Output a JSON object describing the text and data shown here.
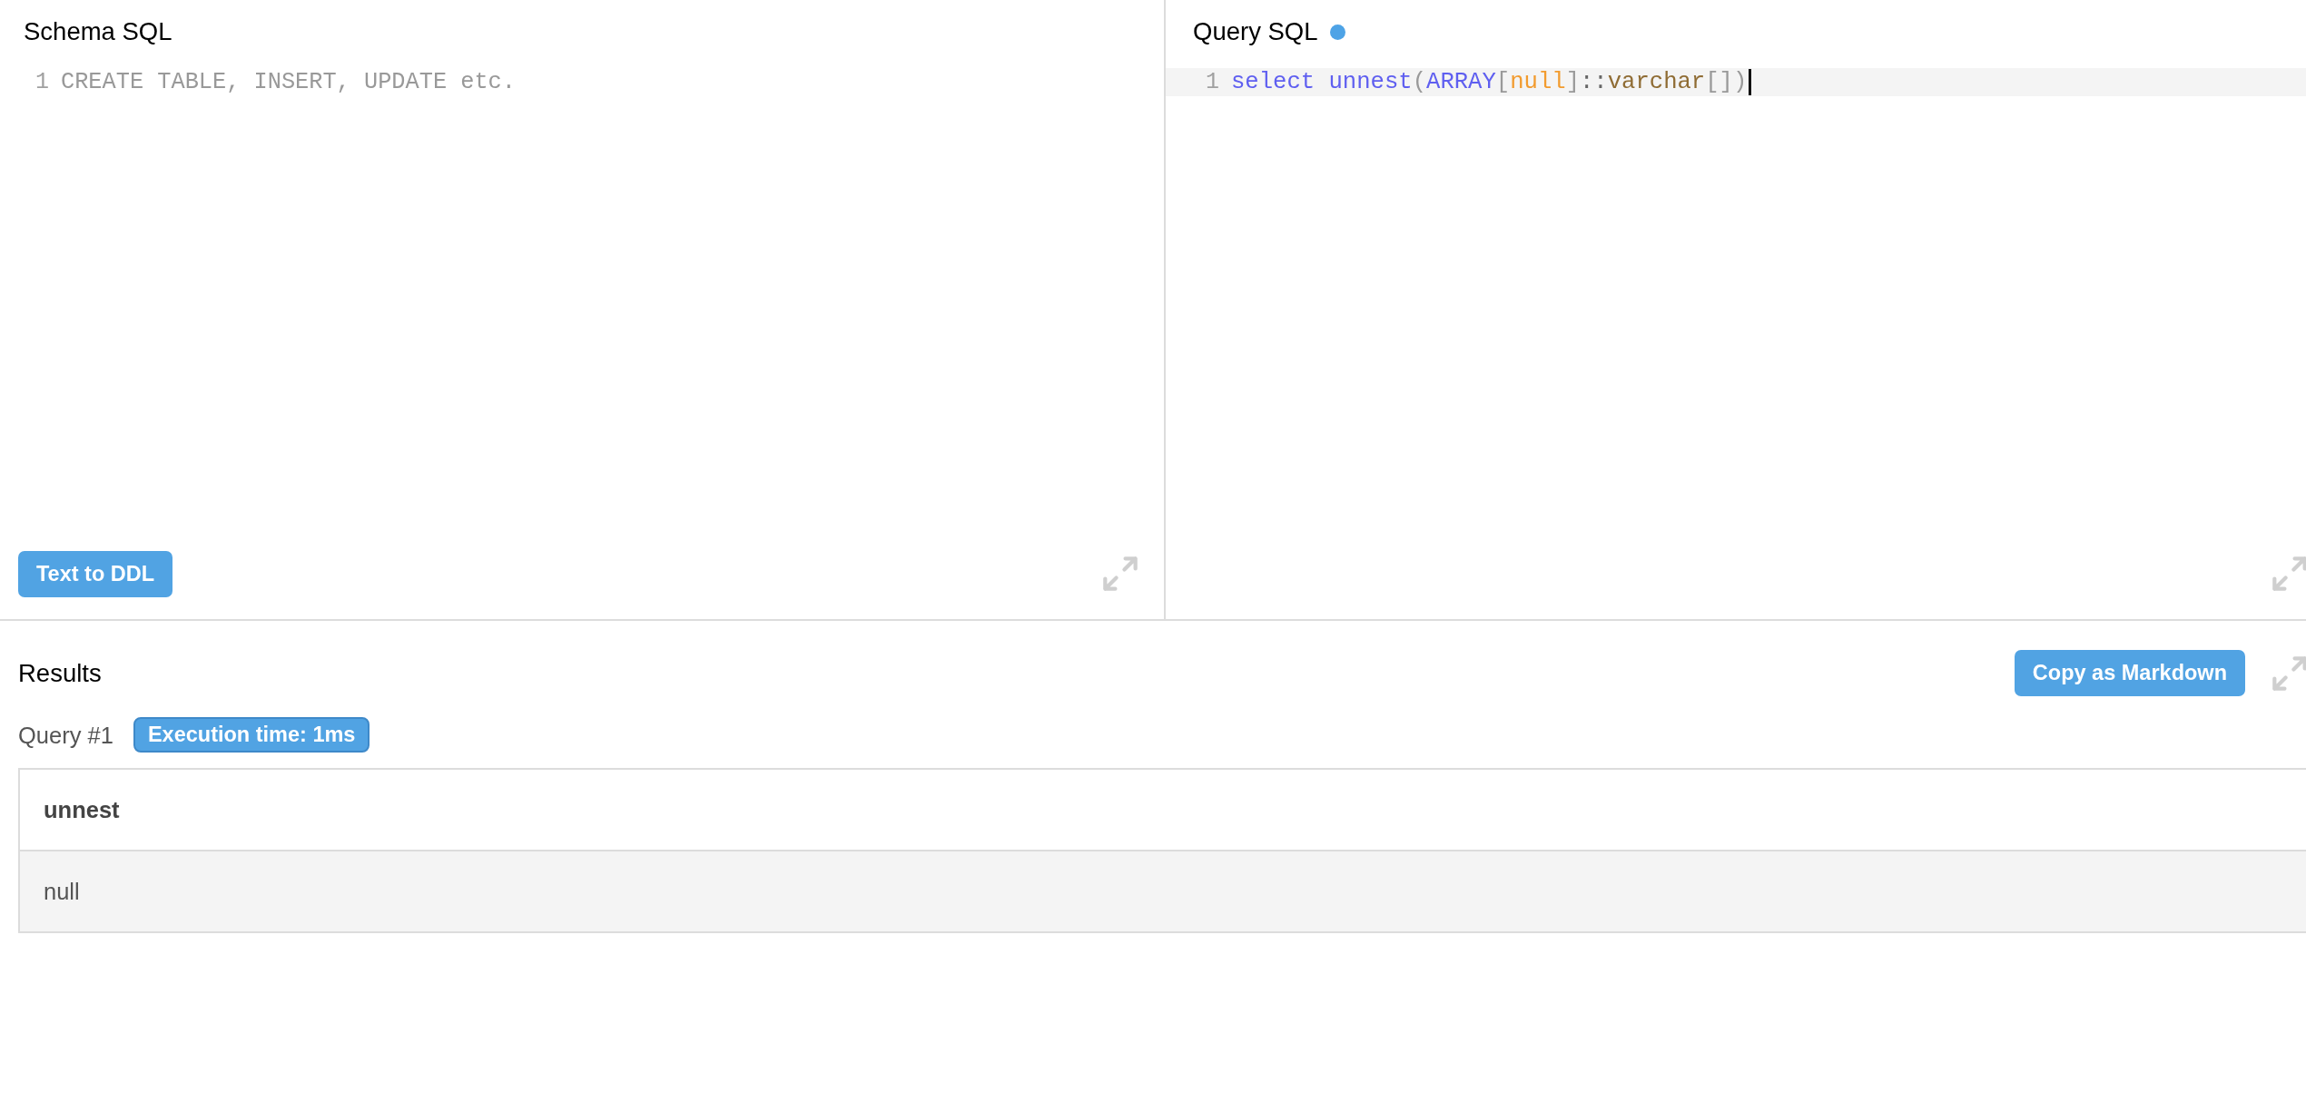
{
  "schema_panel": {
    "title": "Schema SQL",
    "editor": {
      "lines": [
        {
          "number": "1",
          "active": false,
          "placeholder": "CREATE TABLE, INSERT, UPDATE etc."
        }
      ]
    },
    "button": "Text to DDL"
  },
  "query_panel": {
    "title": "Query SQL",
    "unsaved": true,
    "editor": {
      "lines": [
        {
          "number": "1",
          "active": true,
          "tokens": [
            {
              "kind": "keyword",
              "text": "select unnest"
            },
            {
              "kind": "bracket",
              "text": "("
            },
            {
              "kind": "keyword",
              "text": "ARRAY"
            },
            {
              "kind": "bracket",
              "text": "["
            },
            {
              "kind": "atom",
              "text": "null"
            },
            {
              "kind": "bracket",
              "text": "]"
            },
            {
              "kind": "operator",
              "text": "::"
            },
            {
              "kind": "type",
              "text": "varchar"
            },
            {
              "kind": "bracket",
              "text": "[]"
            },
            {
              "kind": "bracket",
              "text": ")"
            }
          ]
        }
      ]
    }
  },
  "results": {
    "title": "Results",
    "button": "Copy as Markdown",
    "queries": [
      {
        "label": "Query #1",
        "badge": "Execution time: 1ms",
        "table": {
          "columns": [
            "unnest"
          ],
          "rows": [
            [
              "null"
            ]
          ]
        }
      }
    ]
  }
}
